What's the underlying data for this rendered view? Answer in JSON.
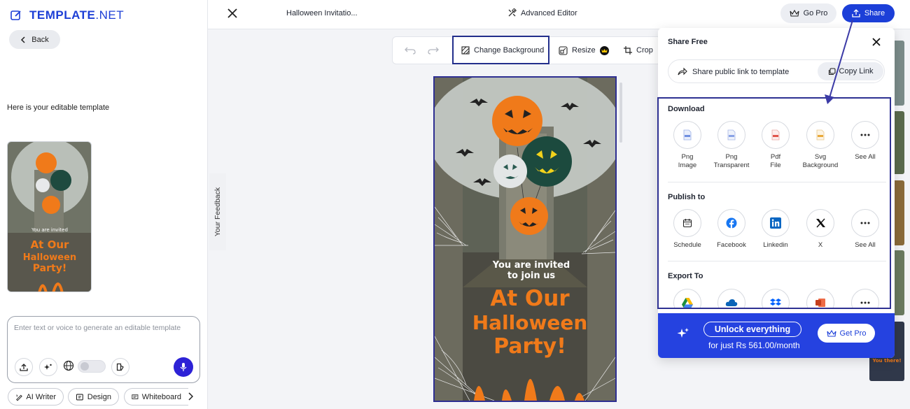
{
  "brand": {
    "logo_bold": "TEMPLATE",
    "logo_light": ".NET"
  },
  "left": {
    "back_label": "Back",
    "editable_note": "Here is your editable template",
    "prompt_placeholder": "Enter text or voice to generate an editable template",
    "chips": [
      "AI Writer",
      "Design",
      "Whiteboard"
    ]
  },
  "feedback_label": "Your Feedback",
  "topbar": {
    "title": "Halloween Invitatio...",
    "advanced_editor": "Advanced Editor",
    "go_pro": "Go Pro",
    "share": "Share"
  },
  "toolbar": {
    "change_background": "Change Background",
    "resize": "Resize",
    "crop": "Crop"
  },
  "flyer": {
    "invite_line1": "You are invited",
    "invite_line2": "to join us",
    "headline_line1": "At Our",
    "headline_line2": "Halloween",
    "headline_line3": "Party!"
  },
  "strip_partial_text": "You there!",
  "share_panel": {
    "title": "Share Free",
    "public_link": "Share public link to template",
    "copy_link": "Copy Link",
    "download": {
      "title": "Download",
      "options": [
        {
          "line1": "Png",
          "line2": "Image",
          "icon": "png-image-icon"
        },
        {
          "line1": "Png",
          "line2": "Transparent",
          "icon": "png-transparent-icon"
        },
        {
          "line1": "Pdf",
          "line2": "File",
          "icon": "pdf-file-icon"
        },
        {
          "line1": "Svg",
          "line2": "Background",
          "icon": "svg-background-icon"
        },
        {
          "line1": "See All",
          "line2": "",
          "icon": "more-icon"
        }
      ]
    },
    "publish": {
      "title": "Publish to",
      "options": [
        {
          "line1": "Schedule",
          "icon": "calendar-icon"
        },
        {
          "line1": "Facebook",
          "icon": "facebook-icon"
        },
        {
          "line1": "Linkedin",
          "icon": "linkedin-icon"
        },
        {
          "line1": "X",
          "icon": "x-icon"
        },
        {
          "line1": "See All",
          "icon": "more-icon"
        }
      ]
    },
    "export": {
      "title": "Export To"
    },
    "unlock": {
      "title": "Unlock everything",
      "subtitle": "for just Rs 561.00/month",
      "button": "Get Pro"
    }
  },
  "colors": {
    "brand_blue": "#1c3fd8",
    "accent_orange": "#f07a1a",
    "highlight_border": "#2e3192"
  }
}
